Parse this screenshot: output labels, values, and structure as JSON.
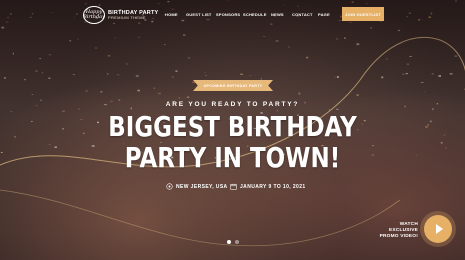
{
  "logo": {
    "badge": "Happy Birthday",
    "title": "BIRTHDAY PARTY",
    "subtitle": "PREMIUM THEME"
  },
  "nav": {
    "items": [
      "HOME",
      "GUEST LIST",
      "SPONSORS",
      "SCHEDULE",
      "NEWS",
      "CONTACT",
      "PAGE"
    ],
    "cta": "JOIN GUESTLIST"
  },
  "hero": {
    "ribbon": "UPCOMING BIRTHDAY PARTY",
    "eyebrow": "ARE YOU READY TO PARTY?",
    "headline_line1": "BIGGEST BIRTHDAY",
    "headline_line2": "PARTY IN TOWN!",
    "location": "NEW JERSEY, USA",
    "dates": "JANUARY 9 TO 10, 2021",
    "slides": 2,
    "active_slide": 1
  },
  "promo": {
    "line1": "WATCH EXCLUSIVE",
    "line2": "PROMO VIDEO!",
    "icon": "play-icon"
  },
  "colors": {
    "accent": "#e6b066",
    "curve": "#e9c48a"
  }
}
